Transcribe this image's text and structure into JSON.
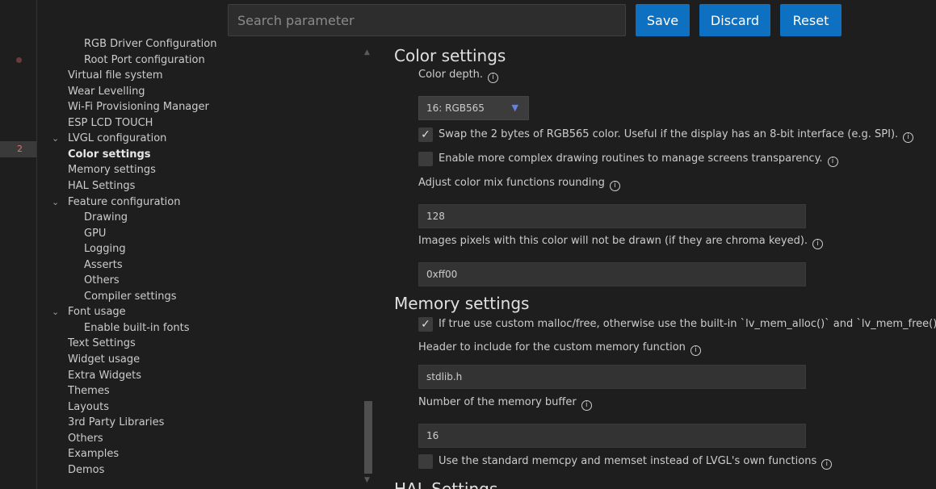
{
  "activity": {
    "line_number": "2"
  },
  "toolbar": {
    "search_placeholder": "Search parameter",
    "save_label": "Save",
    "discard_label": "Discard",
    "reset_label": "Reset"
  },
  "tree": {
    "items": [
      {
        "label": "RGB Driver Configuration",
        "level": 3,
        "chevron": ""
      },
      {
        "label": "Root Port configuration",
        "level": 3,
        "chevron": ""
      },
      {
        "label": "Virtual file system",
        "level": 1,
        "chevron": ""
      },
      {
        "label": "Wear Levelling",
        "level": 1,
        "chevron": ""
      },
      {
        "label": "Wi-Fi Provisioning Manager",
        "level": 1,
        "chevron": ""
      },
      {
        "label": "ESP LCD TOUCH",
        "level": 1,
        "chevron": ""
      },
      {
        "label": "LVGL configuration",
        "level": 1,
        "chevron": "⌄"
      },
      {
        "label": "Color settings",
        "level": 2,
        "chevron": "",
        "bold": true
      },
      {
        "label": "Memory settings",
        "level": 2,
        "chevron": ""
      },
      {
        "label": "HAL Settings",
        "level": 2,
        "chevron": ""
      },
      {
        "label": "Feature configuration",
        "level": 2,
        "chevron": "⌄"
      },
      {
        "label": "Drawing",
        "level": 3,
        "chevron": ""
      },
      {
        "label": "GPU",
        "level": 3,
        "chevron": ""
      },
      {
        "label": "Logging",
        "level": 3,
        "chevron": ""
      },
      {
        "label": "Asserts",
        "level": 3,
        "chevron": ""
      },
      {
        "label": "Others",
        "level": 3,
        "chevron": ""
      },
      {
        "label": "Compiler settings",
        "level": 3,
        "chevron": ""
      },
      {
        "label": "Font usage",
        "level": 2,
        "chevron": "⌄"
      },
      {
        "label": "Enable built-in fonts",
        "level": 3,
        "chevron": ""
      },
      {
        "label": "Text Settings",
        "level": 2,
        "chevron": ""
      },
      {
        "label": "Widget usage",
        "level": 2,
        "chevron": ""
      },
      {
        "label": "Extra Widgets",
        "level": 2,
        "chevron": ""
      },
      {
        "label": "Themes",
        "level": 2,
        "chevron": ""
      },
      {
        "label": "Layouts",
        "level": 2,
        "chevron": ""
      },
      {
        "label": "3rd Party Libraries",
        "level": 2,
        "chevron": ""
      },
      {
        "label": "Others",
        "level": 2,
        "chevron": ""
      },
      {
        "label": "Examples",
        "level": 2,
        "chevron": ""
      },
      {
        "label": "Demos",
        "level": 2,
        "chevron": ""
      }
    ]
  },
  "color_settings": {
    "title": "Color settings",
    "color_depth_label": "Color depth.",
    "color_depth_value": "16: RGB565",
    "swap_label": "Swap the 2 bytes of RGB565 color. Useful if the display has an 8-bit interface (e.g. SPI).",
    "swap_checked": "✓",
    "complex_label": "Enable more complex drawing routines to manage screens transparency.",
    "complex_checked": "",
    "mix_label": "Adjust color mix functions rounding",
    "mix_value": "128",
    "chroma_label": "Images pixels with this color will not be drawn (if they are chroma keyed).",
    "chroma_value": "0xff00"
  },
  "memory_settings": {
    "title": "Memory settings",
    "custom_malloc_label": "If true use custom malloc/free, otherwise use the built-in `lv_mem_alloc()` and `lv_mem_free()`",
    "custom_malloc_checked": "✓",
    "header_label": "Header to include for the custom memory function",
    "header_value": "stdlib.h",
    "buffer_label": "Number of the memory buffer",
    "buffer_value": "16",
    "memcpy_label": "Use the standard memcpy and memset instead of LVGL's own functions",
    "memcpy_checked": ""
  },
  "hal_settings": {
    "title": "HAL Settings"
  },
  "icons": {
    "info": "i"
  }
}
